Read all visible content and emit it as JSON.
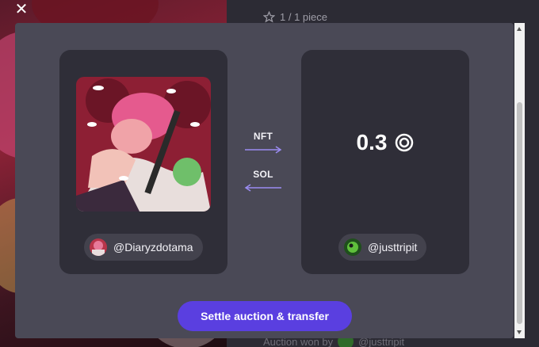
{
  "background": {
    "pieces_text": "1 / 1 piece",
    "auction_won_text": "Auction won by",
    "auction_winner": "@justtripit"
  },
  "modal": {
    "close_icon": "close-icon",
    "seller": {
      "handle": "@Diaryzdotama"
    },
    "buyer": {
      "handle": "@justtripit"
    },
    "price": {
      "amount": "0.3",
      "currency_icon": "sol-icon"
    },
    "transfer_nft_label": "NFT",
    "transfer_sol_label": "SOL",
    "settle_button_label": "Settle auction & transfer"
  },
  "colors": {
    "modal_bg": "#4a4956",
    "card_bg": "#2f2e38",
    "pill_bg": "#43424d",
    "accent": "#5a3fe0",
    "arrow": "#9b8cf2"
  }
}
